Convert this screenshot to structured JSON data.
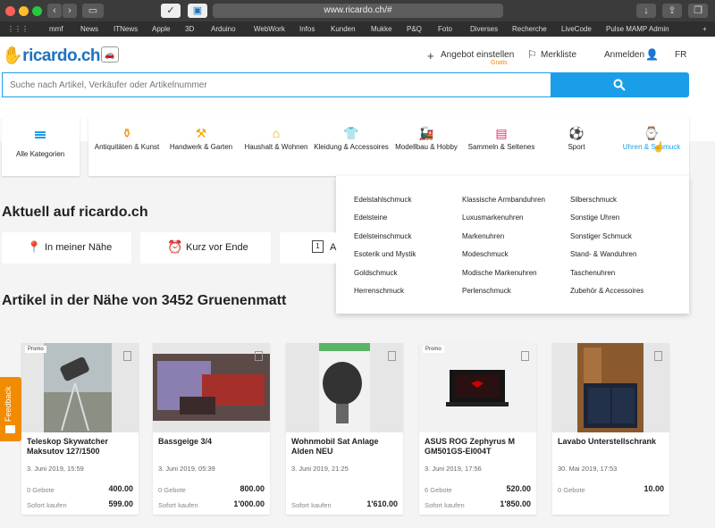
{
  "browser": {
    "url": "www.ricardo.ch/#",
    "bookmarks": [
      "mmf",
      "News",
      "ITNews",
      "Apple",
      "3D",
      "Arduino",
      "WebWork",
      "Infos",
      "Kunden",
      "Mukke",
      "P&Q",
      "Foto",
      "Diverses",
      "Recherche",
      "LiveCode",
      "Pulse MAMP Admin"
    ]
  },
  "header": {
    "logo": "ricardo.ch",
    "sell": "Angebot einstellen",
    "sell_sub": "Gratis",
    "watchlist": "Merkliste",
    "login": "Anmelden",
    "lang": "FR"
  },
  "search": {
    "placeholder": "Suche nach Artikel, Verkäufer oder Artikelnummer"
  },
  "categories": {
    "all": "Alle Kategorien",
    "items": [
      {
        "label": "Antiquitäten & Kunst",
        "icon": "vase-icon"
      },
      {
        "label": "Handwerk & Garten",
        "icon": "tools-icon"
      },
      {
        "label": "Haushalt & Wohnen",
        "icon": "kitchen-icon"
      },
      {
        "label": "Kleidung & Accessoires",
        "icon": "shirt-icon"
      },
      {
        "label": "Modellbau & Hobby",
        "icon": "train-icon"
      },
      {
        "label": "Sammeln & Seltenes",
        "icon": "stamp-icon"
      },
      {
        "label": "Sport",
        "icon": "ball-icon"
      },
      {
        "label": "Uhren & Schmuck",
        "icon": "watch-icon"
      }
    ]
  },
  "dropdown": {
    "col1": [
      "Edelstahlschmuck",
      "Edelsteine",
      "Edelsteinschmuck",
      "Esoterik und Mystik",
      "Goldschmuck",
      "Herrenschmuck"
    ],
    "col2": [
      "Klassische Armbanduhren",
      "Luxusmarkenuhren",
      "Markenuhren",
      "Modeschmuck",
      "Modische Markenuhren",
      "Perlenschmuck"
    ],
    "col3": [
      "Silberschmuck",
      "Sonstige Uhren",
      "Sonstiger Schmuck",
      "Stand- & Wanduhren",
      "Taschenuhren",
      "Zubehör & Accessoires"
    ]
  },
  "current": {
    "title": "Aktuell auf ricardo.ch",
    "near": "In meiner Nähe",
    "ending": "Kurz vor Ende",
    "third": "A"
  },
  "nearby": {
    "title": "Artikel in der Nähe von 3452 Gruenenmatt"
  },
  "labels": {
    "bids": "Gebote",
    "buy": "Sofort kaufen",
    "promo": "Promo",
    "feedback": "Feedback"
  },
  "articles": [
    {
      "title": "Teleskop Skywatcher Maksutov 127/1500",
      "date": "3. Juni 2019, 15:59",
      "bids": "0 Gebote",
      "bid_price": "400.00",
      "buy_price": "599.00",
      "promo": true
    },
    {
      "title": "Bassgeige 3/4",
      "date": "3. Juni 2019, 05:39",
      "bids": "0 Gebote",
      "bid_price": "800.00",
      "buy_price": "1'000.00",
      "promo": false
    },
    {
      "title": "Wohnmobil Sat Anlage Alden NEU",
      "date": "3. Juni 2019, 21:25",
      "bids": "",
      "bid_price": "",
      "buy_price": "1'610.00",
      "promo": false
    },
    {
      "title": "ASUS ROG Zephyrus M GM501GS-EI004T",
      "date": "3. Juni 2019, 17:56",
      "bids": "6 Gebote",
      "bid_price": "520.00",
      "buy_price": "1'850.00",
      "promo": true
    },
    {
      "title": "Lavabo Unterstellschrank",
      "date": "30. Mai 2019, 17:53",
      "bids": "0 Gebote",
      "bid_price": "10.00",
      "buy_price": "",
      "promo": false
    }
  ],
  "colors": {
    "brand_blue": "#1b9ee8",
    "brand_orange": "#f28b00",
    "accent_link": "#1e73be"
  }
}
